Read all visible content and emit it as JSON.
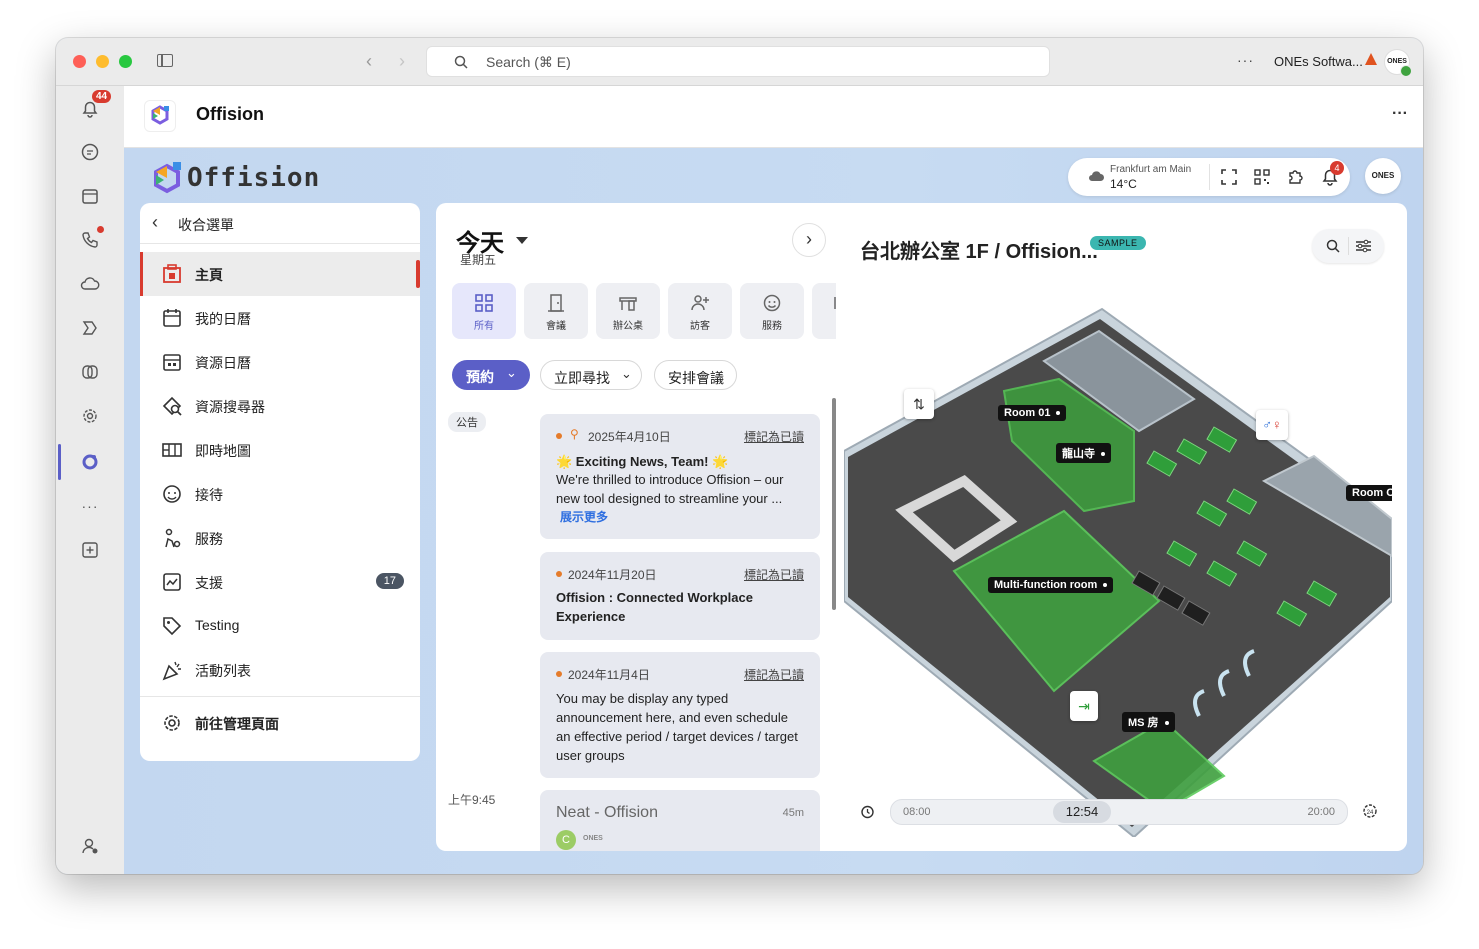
{
  "titlebar": {
    "search_placeholder": "Search (⌘ E)",
    "more": "···",
    "org_name": "ONEs Softwa...",
    "avatar_text": "ONES"
  },
  "rail": {
    "notifications_badge": "44"
  },
  "app_header": {
    "title": "Offision",
    "menu": "···"
  },
  "brand": {
    "logo_text": "Offision"
  },
  "weather": {
    "city": "Frankfurt am Main",
    "temp": "14°C",
    "alert_badge": "4",
    "avatar_text": "ONES"
  },
  "sidebar": {
    "collapse_label": "收合選單",
    "items": [
      {
        "label": "主頁",
        "icon": "home-icon",
        "active": true
      },
      {
        "label": "我的日曆",
        "icon": "calendar-icon"
      },
      {
        "label": "資源日曆",
        "icon": "resource-calendar-icon"
      },
      {
        "label": "資源搜尋器",
        "icon": "resource-search-icon"
      },
      {
        "label": "即時地圖",
        "icon": "map-icon"
      },
      {
        "label": "接待",
        "icon": "reception-icon"
      },
      {
        "label": "服務",
        "icon": "service-icon"
      },
      {
        "label": "支援",
        "icon": "support-icon",
        "badge": "17"
      },
      {
        "label": "Testing",
        "icon": "tag-icon"
      },
      {
        "label": "活動列表",
        "icon": "party-icon"
      }
    ],
    "admin_label": "前往管理頁面"
  },
  "day": {
    "title": "今天",
    "weekday": "星期五"
  },
  "categories": [
    {
      "label": "所有",
      "icon": "grid-icon",
      "active": true
    },
    {
      "label": "會議",
      "icon": "door-icon"
    },
    {
      "label": "辦公桌",
      "icon": "desk-icon"
    },
    {
      "label": "訪客",
      "icon": "visitor-icon"
    },
    {
      "label": "服務",
      "icon": "service-face-icon"
    },
    {
      "label": "",
      "icon": "more-category-icon"
    }
  ],
  "actions": {
    "reserve": "預約",
    "find_now": "立即尋找",
    "schedule": "安排會議"
  },
  "feed": {
    "announcement_tag": "公告",
    "time_label": "上午9:45",
    "cards": [
      {
        "date": "2025年4月10日",
        "mark": "標記為已讀",
        "headline": "🌟 Exciting News, Team! 🌟",
        "text": "We're thrilled to introduce Offision – our new tool designed to streamline your ...",
        "more": "展示更多"
      },
      {
        "date": "2024年11月20日",
        "mark": "標記為已讀",
        "text": "Offision : Connected Workplace Experience"
      },
      {
        "date": "2024年11月4日",
        "mark": "標記為已讀",
        "text": "You may be display any typed announcement here, and even schedule an effective period / target devices / target user groups"
      }
    ],
    "event": {
      "title": "Neat - Offision",
      "duration": "45m",
      "avatar_letter": "C",
      "org": "ONES"
    }
  },
  "map": {
    "title": "台北辦公室 1F / Offision...",
    "sample_badge": "SAMPLE",
    "labels": {
      "room01": "Room 01",
      "longshan": "龍山寺",
      "multi": "Multi-function room",
      "ms": "MS 房",
      "roomc": "Room C"
    },
    "time_start": "08:00",
    "time_current": "12:54",
    "time_end": "20:00"
  }
}
